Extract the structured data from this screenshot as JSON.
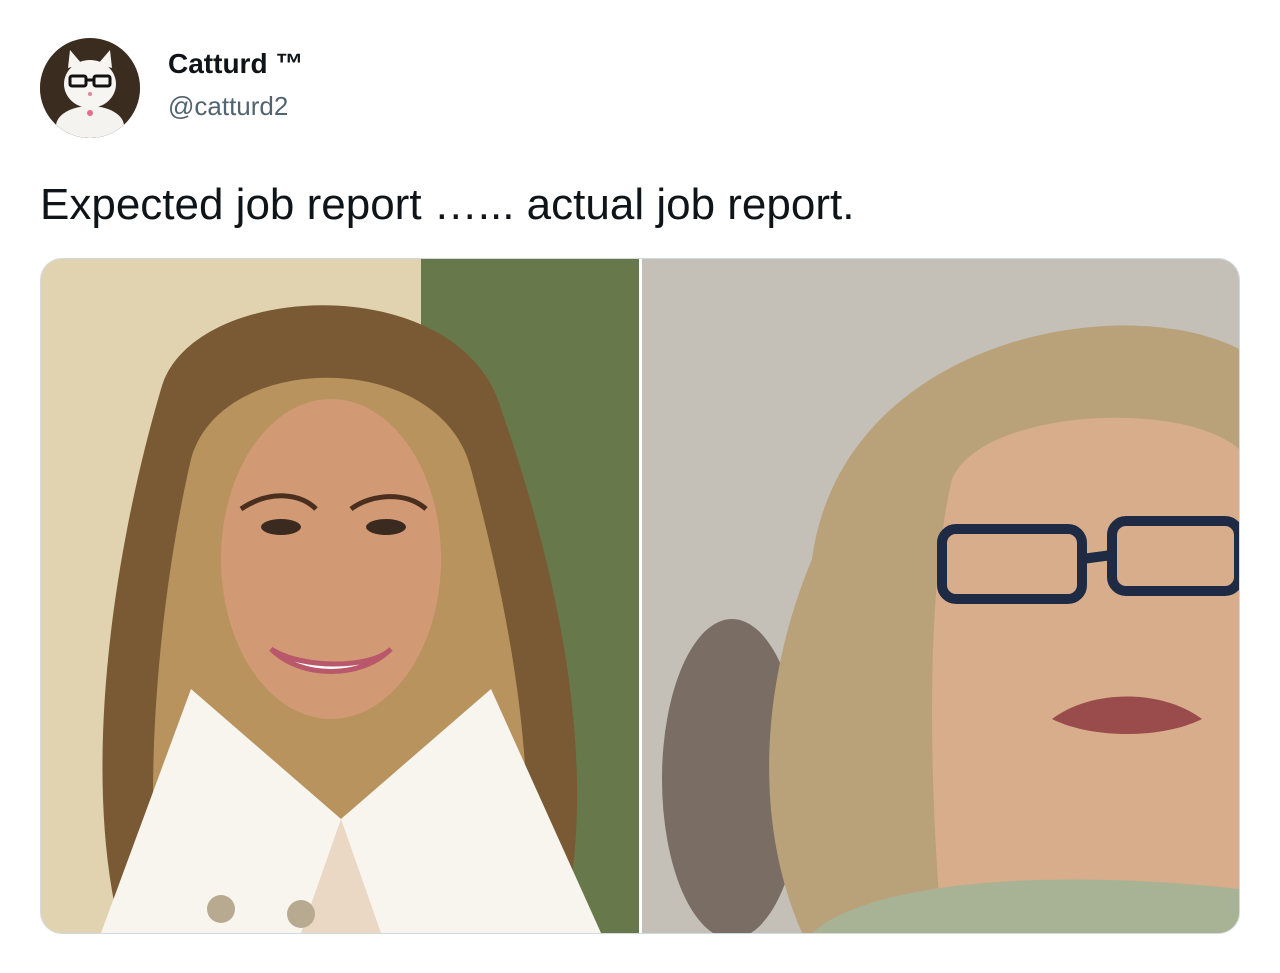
{
  "author": {
    "display_name": "Catturd ™",
    "handle": "@catturd2",
    "avatar_icon": "cat-with-glasses-avatar"
  },
  "tweet": {
    "text": "Expected job report …... actual job report."
  },
  "media": {
    "images": [
      {
        "icon": "photo-smiling-woman-long-hair"
      },
      {
        "icon": "photo-woman-glasses-frowning"
      }
    ]
  },
  "colors": {
    "text_primary": "#0f1419",
    "text_secondary": "#536471",
    "media_border": "#cfd9de"
  }
}
